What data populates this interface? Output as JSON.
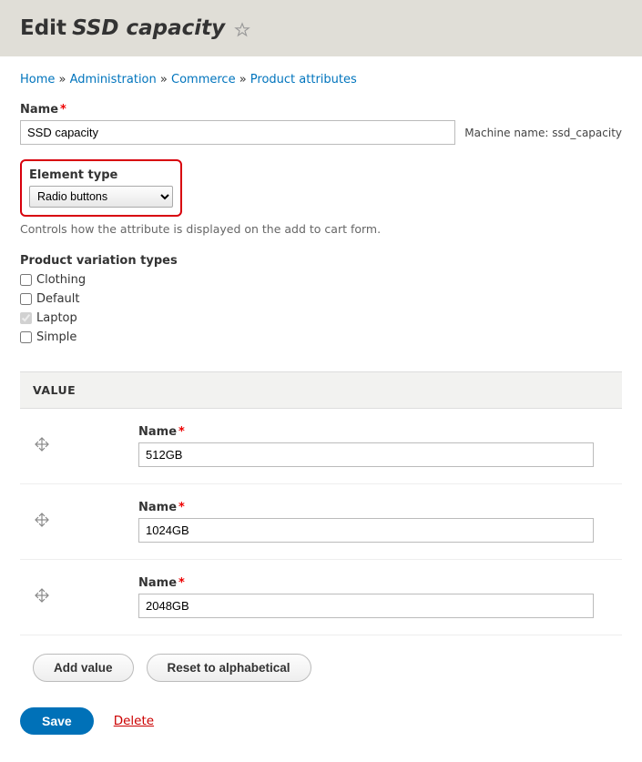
{
  "title": {
    "edit": "Edit",
    "entity": "SSD capacity"
  },
  "breadcrumb": {
    "home": "Home",
    "admin": "Administration",
    "commerce": "Commerce",
    "attrs": "Product attributes",
    "sep": " » "
  },
  "name": {
    "label": "Name",
    "value": "SSD capacity",
    "machine_label": "Machine name:",
    "machine_name": "ssd_capacity"
  },
  "element_type": {
    "label": "Element type",
    "value": "Radio buttons",
    "description": "Controls how the attribute is displayed on the add to cart form."
  },
  "variation_types": {
    "label": "Product variation types",
    "items": [
      {
        "label": "Clothing",
        "checked": false
      },
      {
        "label": "Default",
        "checked": false
      },
      {
        "label": "Laptop",
        "checked": true
      },
      {
        "label": "Simple",
        "checked": false
      }
    ]
  },
  "values": {
    "header": "VALUE",
    "name_label": "Name",
    "rows": [
      {
        "value": "512GB"
      },
      {
        "value": "1024GB"
      },
      {
        "value": "2048GB"
      }
    ]
  },
  "buttons": {
    "add_value": "Add value",
    "reset": "Reset to alphabetical",
    "save": "Save",
    "delete": "Delete"
  }
}
